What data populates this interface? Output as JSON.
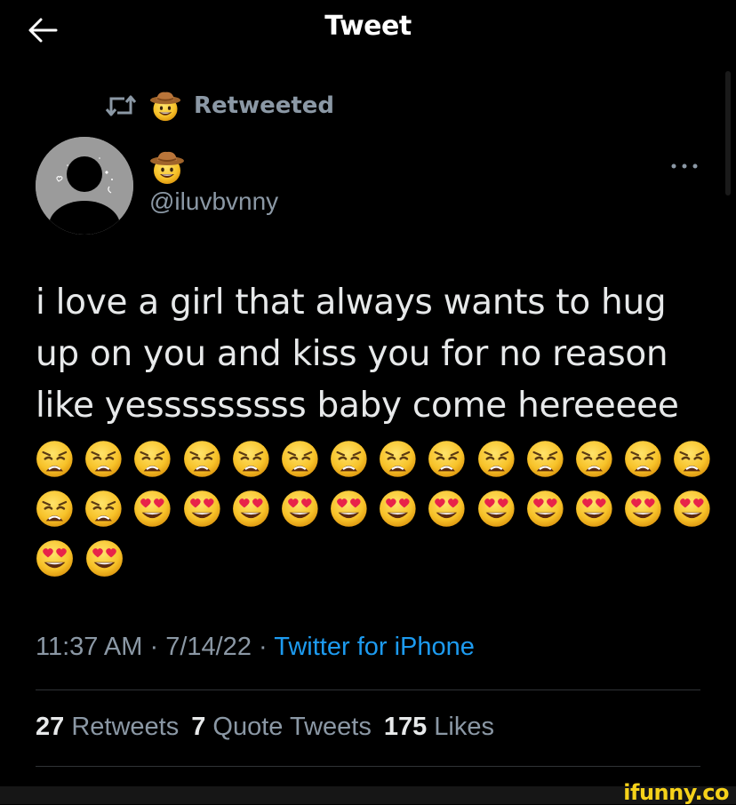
{
  "header": {
    "title": "Tweet",
    "back_icon": "arrow-left-icon"
  },
  "retweet": {
    "label": "Retweeted",
    "icon": "retweet-icon",
    "emoji": "cowboy-hat-face-emoji"
  },
  "author": {
    "display_name_emoji": "cowboy-hat-face-emoji",
    "handle": "@iluvbvnny"
  },
  "tweet": {
    "lines": [
      "i love a girl that always wants to hug",
      "up on you and kiss you for no reason",
      "like yesssssssss baby come hereeeee"
    ],
    "emoji_rows": [
      [
        "weary-face-emoji",
        "weary-face-emoji",
        "weary-face-emoji",
        "weary-face-emoji",
        "weary-face-emoji",
        "weary-face-emoji",
        "weary-face-emoji",
        "weary-face-emoji",
        "weary-face-emoji",
        "weary-face-emoji",
        "weary-face-emoji",
        "weary-face-emoji",
        "weary-face-emoji",
        "weary-face-emoji"
      ],
      [
        "weary-face-emoji",
        "weary-face-emoji",
        "heart-eyes-emoji",
        "heart-eyes-emoji",
        "heart-eyes-emoji",
        "heart-eyes-emoji",
        "heart-eyes-emoji",
        "heart-eyes-emoji",
        "heart-eyes-emoji",
        "heart-eyes-emoji",
        "heart-eyes-emoji",
        "heart-eyes-emoji",
        "heart-eyes-emoji",
        "heart-eyes-emoji"
      ],
      [
        "heart-eyes-emoji",
        "heart-eyes-emoji"
      ]
    ]
  },
  "meta": {
    "time": "11:37 AM",
    "separator": "·",
    "date": "7/14/22",
    "source": "Twitter for iPhone"
  },
  "stats": {
    "retweets_count": "27",
    "retweets_label": "Retweets",
    "quotes_count": "7",
    "quotes_label": "Quote Tweets",
    "likes_count": "175",
    "likes_label": "Likes"
  },
  "watermark": "ifunny.co",
  "colors": {
    "background": "#000000",
    "text": "#e7e9ea",
    "secondary": "#8b98a5",
    "link": "#1d9bf0",
    "divider": "#2f3336",
    "watermark": "#f6d21a"
  }
}
